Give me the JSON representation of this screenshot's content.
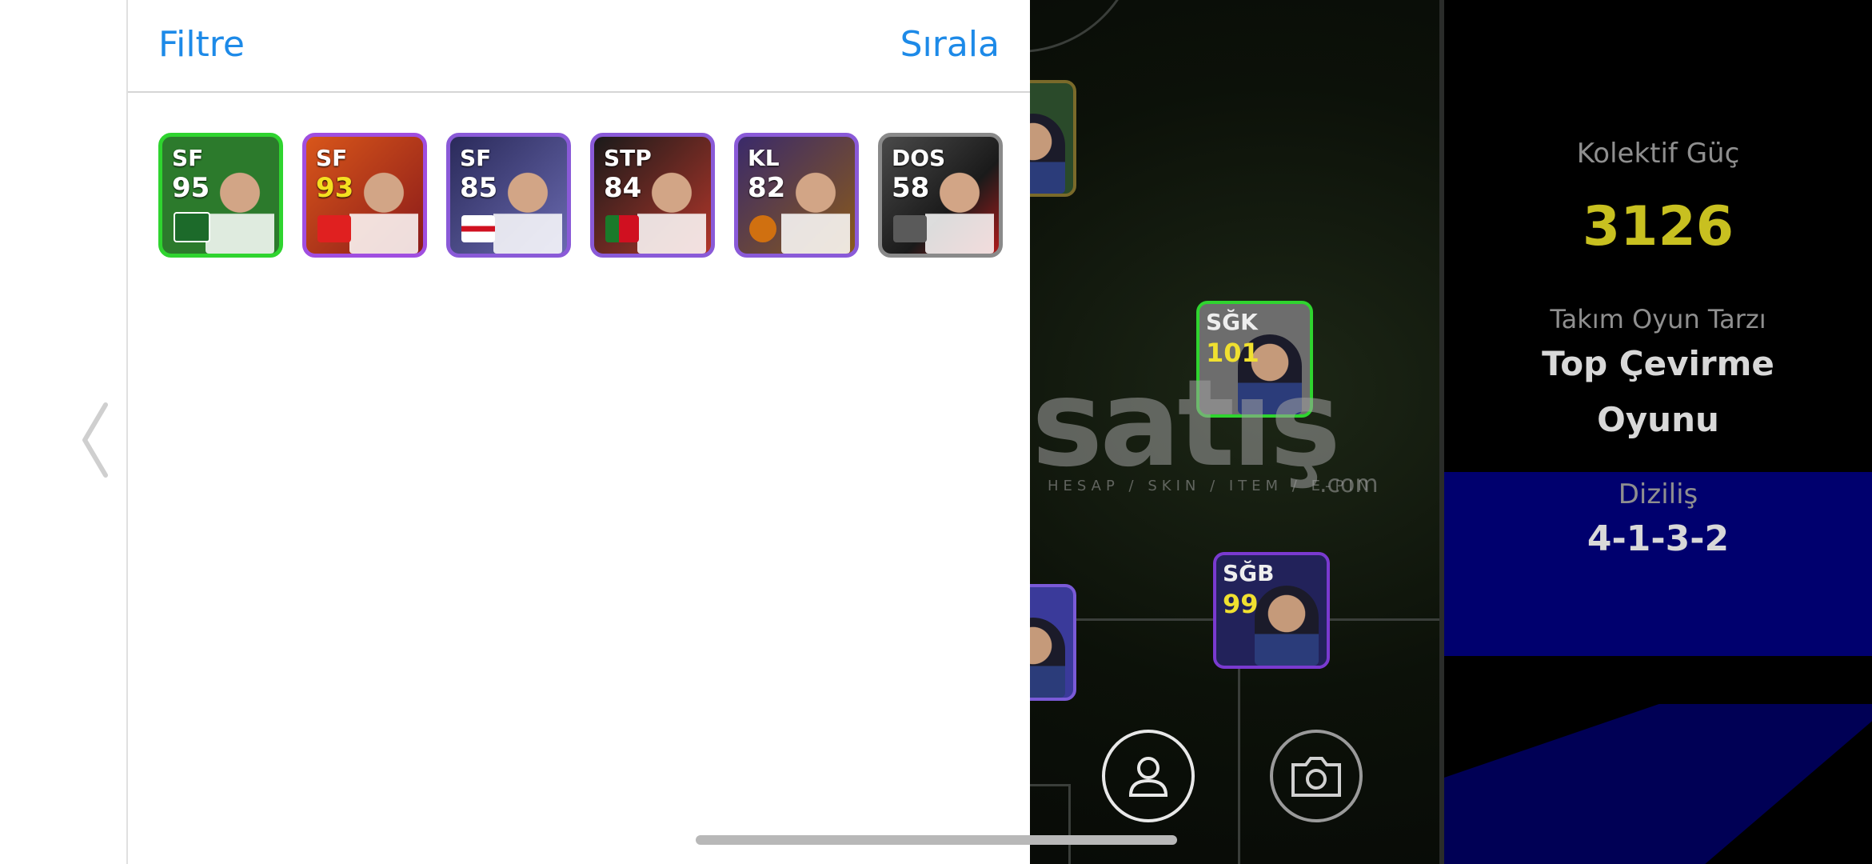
{
  "header": {
    "filter_label": "Filtre",
    "sort_label": "Sırala"
  },
  "cards": [
    {
      "position": "SF",
      "rating": "95",
      "border": "#2fd42f",
      "bg": "#2c7a2c"
    },
    {
      "position": "SF",
      "rating": "93",
      "border": "#a04ee0",
      "bg": "#b8421a"
    },
    {
      "position": "SF",
      "rating": "85",
      "border": "#8a5ad8",
      "bg": "#3a3a9a"
    },
    {
      "position": "STP",
      "rating": "84",
      "border": "#8a5ad8",
      "bg": "#b2362a"
    },
    {
      "position": "KL",
      "rating": "82",
      "border": "#8a5ad8",
      "bg": "#4a3a8a"
    },
    {
      "position": "DOS",
      "rating": "58",
      "border": "#8a8a8a",
      "bg": "#3a3a3a"
    }
  ],
  "panel": {
    "collective_power_label": "Kolektif Güç",
    "collective_power_value": "3126",
    "team_style_label": "Takım Oyun Tarzı",
    "team_style_line1": "Top Çevirme",
    "team_style_line2": "Oyunu",
    "formation_label": "Diziliş",
    "formation_value": "4-1-3-2"
  },
  "field_players": [
    {
      "position": "SĞK",
      "rating": "101",
      "border": "#2fd42f",
      "bg": "#8a8a8a"
    },
    {
      "position": "SĞB",
      "rating": "99",
      "border": "#7a3ad0",
      "bg": "#2a2a6a"
    }
  ],
  "watermark": {
    "main": "satış",
    "sub": "HESAP / SKIN / ITEM / E-PIN",
    "domain": ".com"
  },
  "icons": {
    "back": "chevron-left-icon",
    "profile": "person-icon",
    "camera": "camera-icon"
  },
  "colors": {
    "accent": "#1d8ae8",
    "power_value": "#c8c020"
  }
}
